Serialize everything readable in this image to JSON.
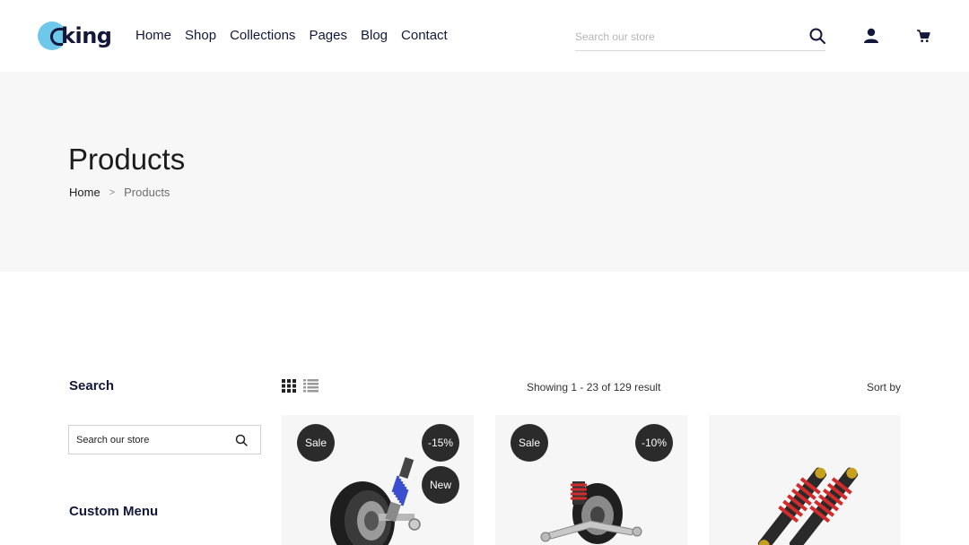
{
  "header": {
    "logo_text": "king",
    "nav": [
      "Home",
      "Shop",
      "Collections",
      "Pages",
      "Blog",
      "Contact"
    ],
    "search_placeholder": "Search our store"
  },
  "banner": {
    "title": "Products",
    "breadcrumb": {
      "home": "Home",
      "separator": ">",
      "current": "Products"
    }
  },
  "sidebar": {
    "search_title": "Search",
    "search_placeholder": "Search our store",
    "custom_menu_title": "Custom Menu"
  },
  "toolbar": {
    "showing": "Showing 1 - 23 of 129 result",
    "sort_by": "Sort by"
  },
  "products": [
    {
      "badge_left": "Sale",
      "badge_right": "-15%",
      "badge_extra": "New"
    },
    {
      "badge_left": "Sale",
      "badge_right": "-10%"
    },
    {}
  ],
  "colors": {
    "accent": "#6ec8ec",
    "dark": "#13183b",
    "badge": "#2b2b2b",
    "spring_blue": "#3a4fd0",
    "spring_red": "#d22b2b"
  }
}
